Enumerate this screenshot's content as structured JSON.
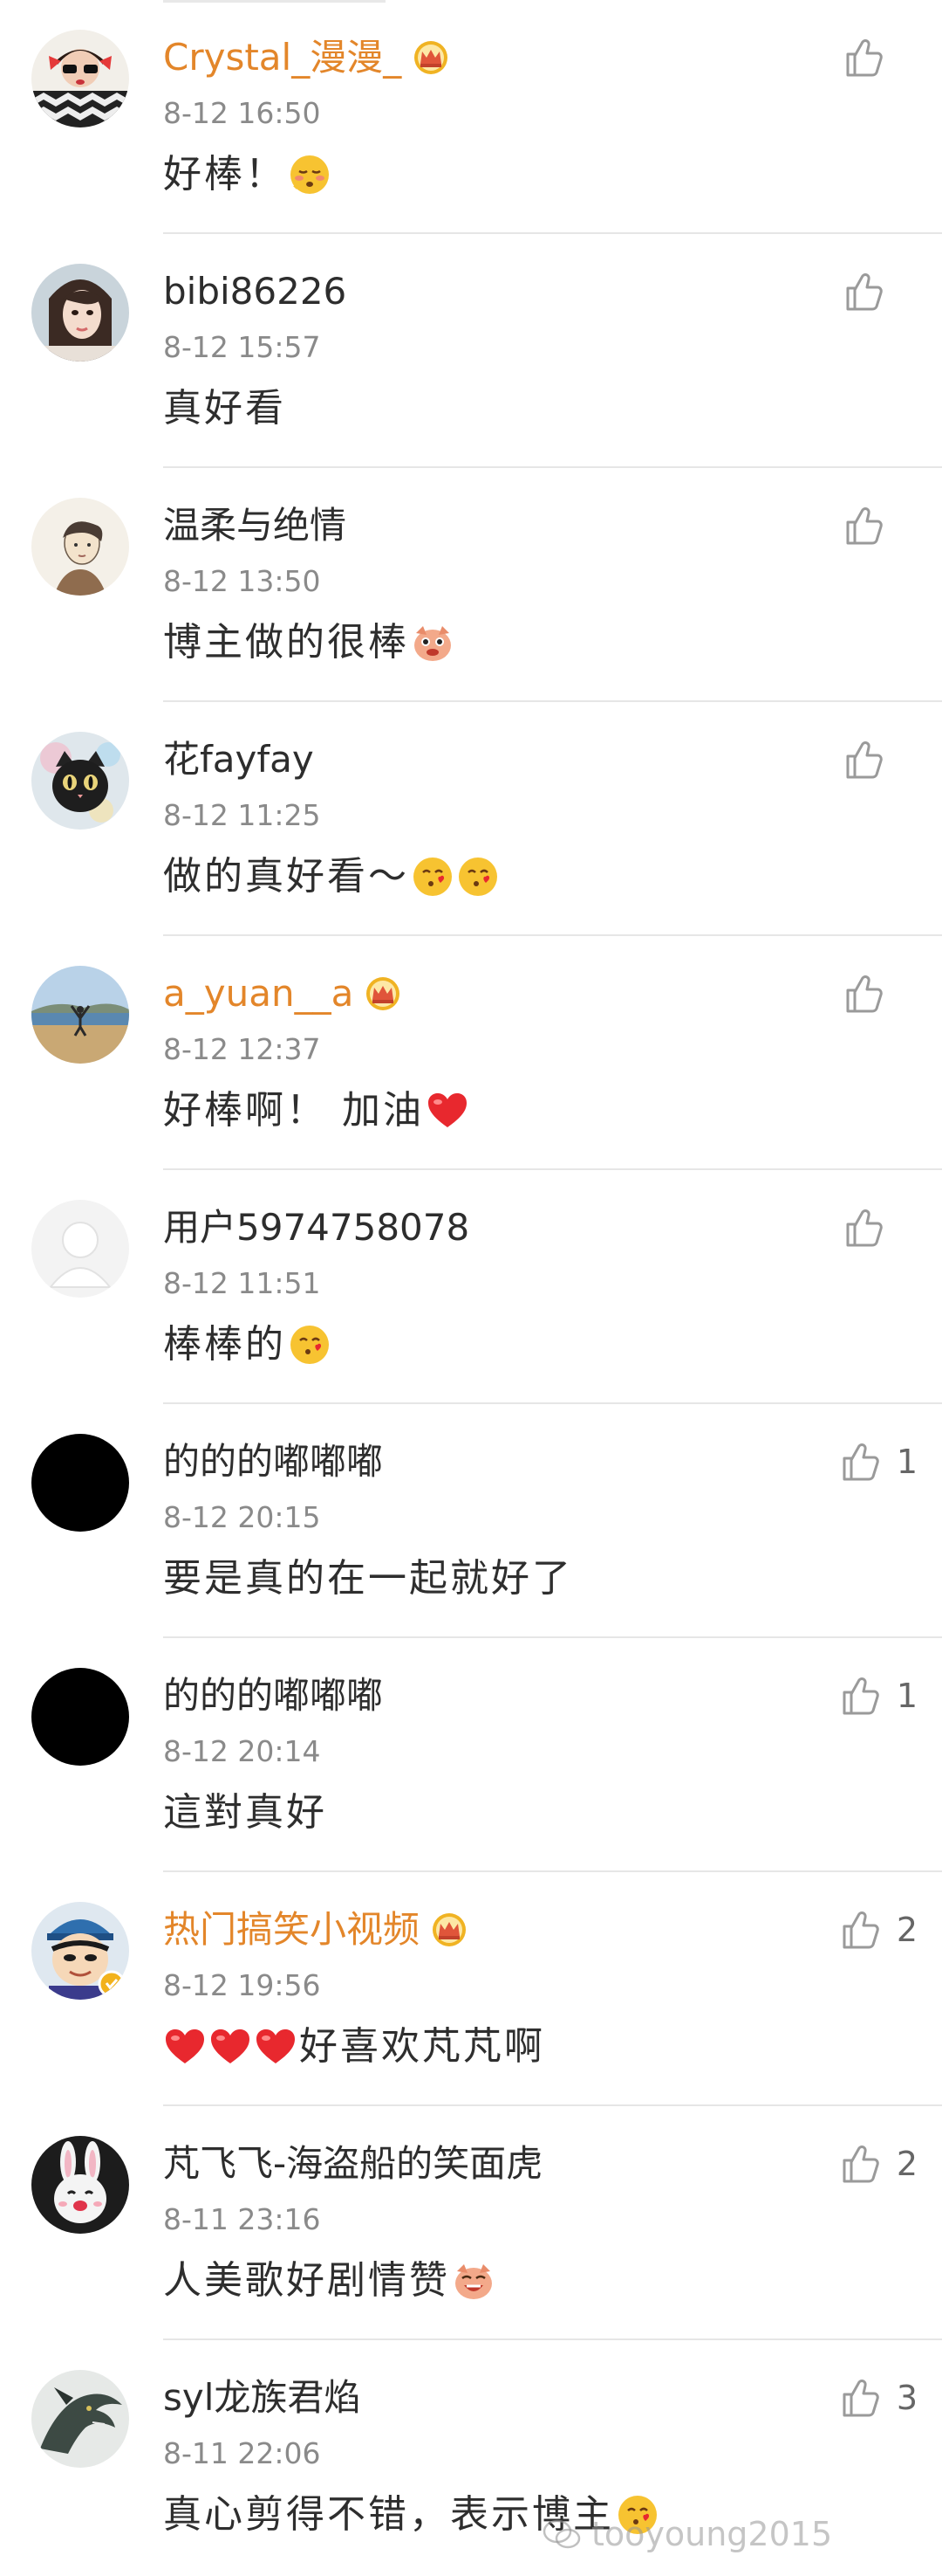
{
  "theme": {
    "vip_name_color": "#e3862a",
    "name_color": "#2d2d2d",
    "time_color": "#8a8a8a",
    "like_icon_color": "#9a9a9a",
    "heart_color": "#e8282e",
    "crown_color": "#f0b323"
  },
  "comments": [
    {
      "username": "Crystal_漫漫_",
      "vip": true,
      "crown": true,
      "time": "8-12 16:50",
      "text": "好棒！",
      "emojis": [
        "shy-emoji"
      ],
      "likes": "",
      "avatar": "avatar-crystal"
    },
    {
      "username": "bibi86226",
      "vip": false,
      "crown": false,
      "time": "8-12 15:57",
      "text": "真好看",
      "emojis": [],
      "likes": "",
      "avatar": "avatar-bibi"
    },
    {
      "username": "温柔与绝情",
      "vip": false,
      "crown": false,
      "time": "8-12 13:50",
      "text": "博主做的很棒",
      "emojis": [
        "pig-emoji"
      ],
      "likes": "",
      "avatar": "avatar-sketch"
    },
    {
      "username": "花fayfay",
      "vip": false,
      "crown": false,
      "time": "8-12 11:25",
      "text": "做的真好看～",
      "emojis": [
        "kiss-emoji",
        "kiss-emoji"
      ],
      "likes": "",
      "avatar": "avatar-cat"
    },
    {
      "username": "a_yuan__a",
      "vip": true,
      "crown": true,
      "time": "8-12 12:37",
      "text": "好棒啊！ 加油",
      "emojis": [
        "heart-emoji"
      ],
      "likes": "",
      "avatar": "avatar-beach"
    },
    {
      "username": "用户5974758078",
      "vip": false,
      "crown": false,
      "time": "8-12 11:51",
      "text": "棒棒的",
      "emojis": [
        "kiss-emoji"
      ],
      "likes": "",
      "avatar": "avatar-default"
    },
    {
      "username": "的的的嘟嘟嘟",
      "vip": false,
      "crown": false,
      "time": "8-12 20:15",
      "text": "要是真的在一起就好了",
      "emojis": [],
      "likes": "1",
      "avatar": "avatar-black"
    },
    {
      "username": "的的的嘟嘟嘟",
      "vip": false,
      "crown": false,
      "time": "8-12 20:14",
      "text": "這對真好",
      "emojis": [],
      "likes": "1",
      "avatar": "avatar-black"
    },
    {
      "username": "热门搞笑小视频",
      "vip": true,
      "crown": true,
      "time": "8-12 19:56",
      "text": "好喜欢芃芃啊",
      "lead_emojis": [
        "heart-emoji",
        "heart-emoji",
        "heart-emoji"
      ],
      "emojis": [],
      "likes": "2",
      "avatar": "avatar-cartoon"
    },
    {
      "username": "芃飞飞-海盗船的笑面虎",
      "vip": false,
      "crown": false,
      "time": "8-11 23:16",
      "text": "人美歌好剧情赞",
      "emojis": [
        "pig-laugh-emoji"
      ],
      "likes": "2",
      "avatar": "avatar-rabbit"
    },
    {
      "username": "syl龙族君焰",
      "vip": false,
      "crown": false,
      "time": "8-11 22:06",
      "text": "真心剪得不错，表示博主",
      "emojis": [
        "kiss-emoji"
      ],
      "likes": "3",
      "avatar": "avatar-dragon"
    }
  ],
  "watermark": {
    "text": "tooyoung2015"
  }
}
